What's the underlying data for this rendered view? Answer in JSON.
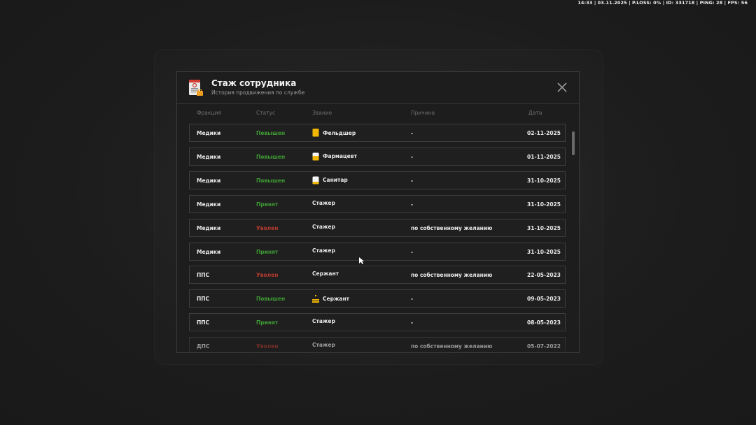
{
  "hud": {
    "text": "14:33 | 03.11.2025 | P.LOSS: 0% | ID: 331718 | PING: 28 | FPS: 56"
  },
  "modal": {
    "title": "Стаж сотрудника",
    "subtitle": "История продвижения по службе",
    "icon": "document-icon",
    "close_icon": "close-icon"
  },
  "columns": {
    "faction": "Фракция",
    "status": "Статус",
    "rank": "Звание",
    "reason": "Причина",
    "date": "Дата"
  },
  "colors": {
    "promoted": "#3e9a34",
    "accepted": "#3e9a34",
    "fired": "#b73b30",
    "rank_icon": "#f2b705"
  },
  "rows": [
    {
      "faction": "Медики",
      "status": "Повышен",
      "status_kind": "green",
      "rank": "Фельдшер",
      "rank_icon": "badge-full-icon",
      "reason": "-",
      "date": "02-11-2025"
    },
    {
      "faction": "Медики",
      "status": "Повышен",
      "status_kind": "green",
      "rank": "Фармацевт",
      "rank_icon": "badge-half-icon",
      "reason": "-",
      "date": "01-11-2025"
    },
    {
      "faction": "Медики",
      "status": "Повышен",
      "status_kind": "green",
      "rank": "Санитар",
      "rank_icon": "badge-low-icon",
      "reason": "-",
      "date": "31-10-2025"
    },
    {
      "faction": "Медики",
      "status": "Принят",
      "status_kind": "green",
      "rank": "Стажер",
      "rank_icon": "",
      "reason": "-",
      "date": "31-10-2025"
    },
    {
      "faction": "Медики",
      "status": "Уволен",
      "status_kind": "red",
      "rank": "Стажер",
      "rank_icon": "",
      "reason": "по собственному желанию",
      "date": "31-10-2025"
    },
    {
      "faction": "Медики",
      "status": "Принят",
      "status_kind": "green",
      "rank": "Стажер",
      "rank_icon": "",
      "reason": "-",
      "date": "31-10-2025"
    },
    {
      "faction": "ППС",
      "status": "Уволен",
      "status_kind": "red",
      "rank": "Сержант",
      "rank_icon": "",
      "reason": "по собственному желанию",
      "date": "22-05-2023"
    },
    {
      "faction": "ППС",
      "status": "Повышен",
      "status_kind": "green",
      "rank": "Сержант",
      "rank_icon": "chevron-rank-icon",
      "reason": "-",
      "date": "09-05-2023"
    },
    {
      "faction": "ППС",
      "status": "Принят",
      "status_kind": "green",
      "rank": "Стажер",
      "rank_icon": "",
      "reason": "-",
      "date": "08-05-2023"
    },
    {
      "faction": "ДПС",
      "status": "Уволен",
      "status_kind": "red",
      "rank": "Стажер",
      "rank_icon": "",
      "reason": "по собственному желанию",
      "date": "05-07-2022"
    }
  ]
}
